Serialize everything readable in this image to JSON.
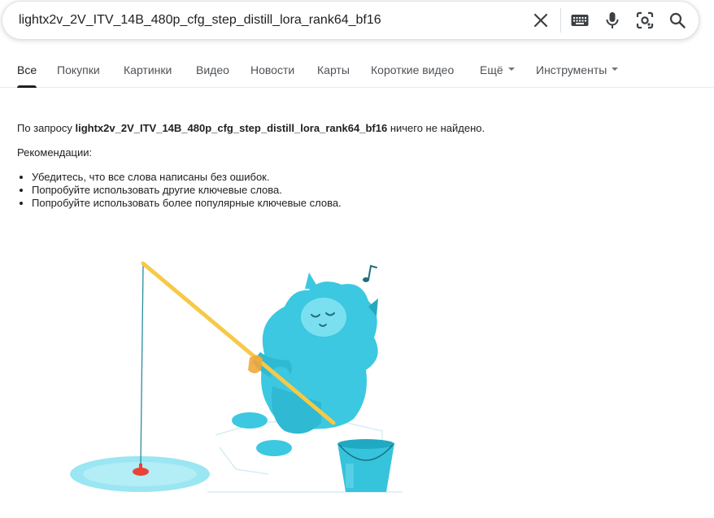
{
  "search": {
    "query": "lightx2v_2V_ITV_14B_480p_cfg_step_distill_lora_rank64_bf16",
    "icons": [
      "clear-icon",
      "keyboard-icon",
      "microphone-icon",
      "lens-icon",
      "search-icon"
    ]
  },
  "tabs": [
    {
      "label": "Все",
      "active": true
    },
    {
      "label": "Покупки"
    },
    {
      "label": "Картинки"
    },
    {
      "label": "Видео"
    },
    {
      "label": "Новости"
    },
    {
      "label": "Карты"
    },
    {
      "label": "Короткие видео"
    },
    {
      "label": "Ещё",
      "dropdown": true
    },
    {
      "label": "Инструменты",
      "dropdown": true
    }
  ],
  "result": {
    "prefix": "По запросу ",
    "query": "lightx2v_2V_ITV_14B_480p_cfg_step_distill_lora_rank64_bf16",
    "suffix": " ничего не найдено.",
    "recommendations_title": "Рекомендации:",
    "recommendations": [
      "Убедитесь, что все слова написаны без ошибок.",
      "Попробуйте использовать другие ключевые слова.",
      "Попробуйте использовать более популярные ключевые слова."
    ]
  },
  "colors": {
    "creature": "#3bc8e0",
    "rod": "#f7c948",
    "bobber": "#ea4335",
    "ice_hole": "#8ee4f0",
    "bucket": "#36c3dc"
  }
}
